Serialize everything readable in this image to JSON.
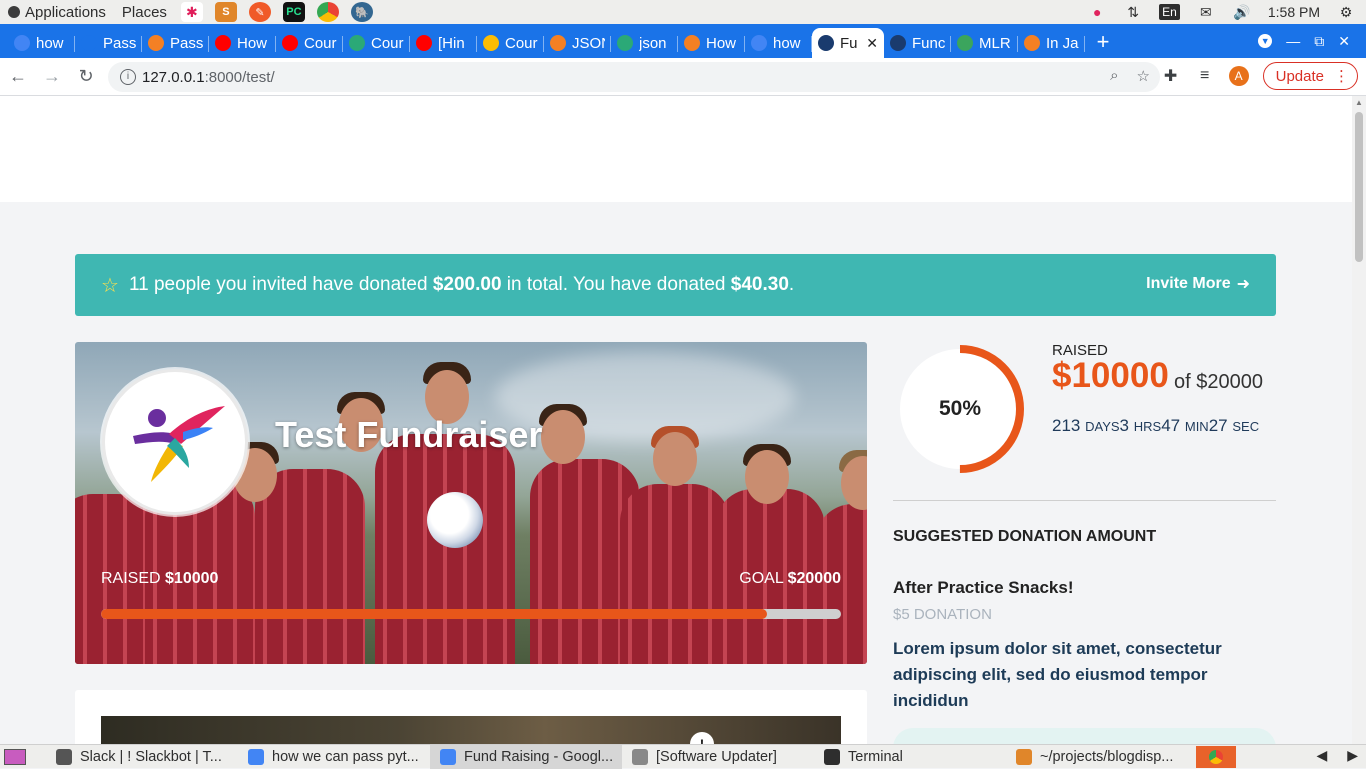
{
  "os": {
    "menu_applications": "Applications",
    "menu_places": "Places",
    "lang": "En",
    "time": "1:58 PM"
  },
  "tabs": [
    {
      "label": "how",
      "icon": "google-icon",
      "color": "#4285f4"
    },
    {
      "label": "Pass",
      "icon": "doc-icon",
      "color": "#1a73e8"
    },
    {
      "label": "Pass",
      "icon": "stackoverflow-icon",
      "color": "#f48024"
    },
    {
      "label": "How",
      "icon": "youtube-icon",
      "color": "#ff0000"
    },
    {
      "label": "Cour",
      "icon": "youtube-icon",
      "color": "#ff0000"
    },
    {
      "label": "Cour",
      "icon": "django-icon",
      "color": "#2ba977"
    },
    {
      "label": "[Hin",
      "icon": "youtube-icon",
      "color": "#ff0000"
    },
    {
      "label": "Cour",
      "icon": "drive-icon",
      "color": "#fbbc04"
    },
    {
      "label": "JSON",
      "icon": "stackoverflow-icon",
      "color": "#f48024"
    },
    {
      "label": "json",
      "icon": "link-icon",
      "color": "#2ba977"
    },
    {
      "label": "How",
      "icon": "stackoverflow-icon",
      "color": "#f48024"
    },
    {
      "label": "how",
      "icon": "google-icon",
      "color": "#4285f4"
    },
    {
      "label": "Fu",
      "icon": "globe-icon",
      "color": "#1a3b6e",
      "active": true
    },
    {
      "label": "Func",
      "icon": "globe-icon",
      "color": "#1a3b6e"
    },
    {
      "label": "MLR",
      "icon": "ml-icon",
      "color": "#3ba55d"
    },
    {
      "label": "In Ja",
      "icon": "stackoverflow-icon",
      "color": "#f48024"
    }
  ],
  "address": {
    "host": "127.0.0.1",
    "path": ":8000/test/"
  },
  "toolbar": {
    "profile_initial": "A",
    "update_label": "Update"
  },
  "notice": {
    "prefix": "11 people you invited have donated ",
    "invited_total": "$200.00",
    "middle": " in total. You have donated ",
    "your_total": "$40.30",
    "suffix": ".",
    "invite_label": "Invite More"
  },
  "hero": {
    "title": "Test Fundraiser",
    "raised_label": "RAISED",
    "raised_value": "$10000",
    "goal_label": "GOAL",
    "goal_value": "$20000",
    "progress_fraction": 0.9
  },
  "stats": {
    "percent_label": "50%",
    "percent_value": 0.5,
    "raised_label": "RAISED",
    "raised_amount": "$10000",
    "of_goal": "of $20000",
    "days": "213",
    "days_unit": "DAYS",
    "hrs": "3",
    "hrs_unit": "HRS",
    "min": "47",
    "min_unit": "MIN",
    "sec": "27",
    "sec_unit": "SEC"
  },
  "donation": {
    "heading": "SUGGESTED DONATION AMOUNT",
    "tier_title": "After Practice Snacks!",
    "tier_amount": "$5 DONATION",
    "tier_description": "Lorem ipsum dolor sit amet, consectetur adipiscing elit, sed do eiusmod tempor incididun"
  },
  "taskbar": [
    {
      "label": "Slack | ! Slackbot | T...",
      "icon": "window-icon",
      "color": "#555555"
    },
    {
      "label": "how we can pass pyt...",
      "icon": "chrome-icon",
      "color": "#4285f4"
    },
    {
      "label": "Fund Raising - Googl...",
      "icon": "chrome-icon",
      "color": "#4285f4",
      "active": true
    },
    {
      "label": "[Software Updater]",
      "icon": "updater-icon",
      "color": "#888888"
    },
    {
      "label": "Terminal",
      "icon": "terminal-icon",
      "color": "#2e2e2e"
    },
    {
      "label": "~/projects/blogdisp...",
      "icon": "sublime-icon",
      "color": "#e0862a"
    }
  ]
}
